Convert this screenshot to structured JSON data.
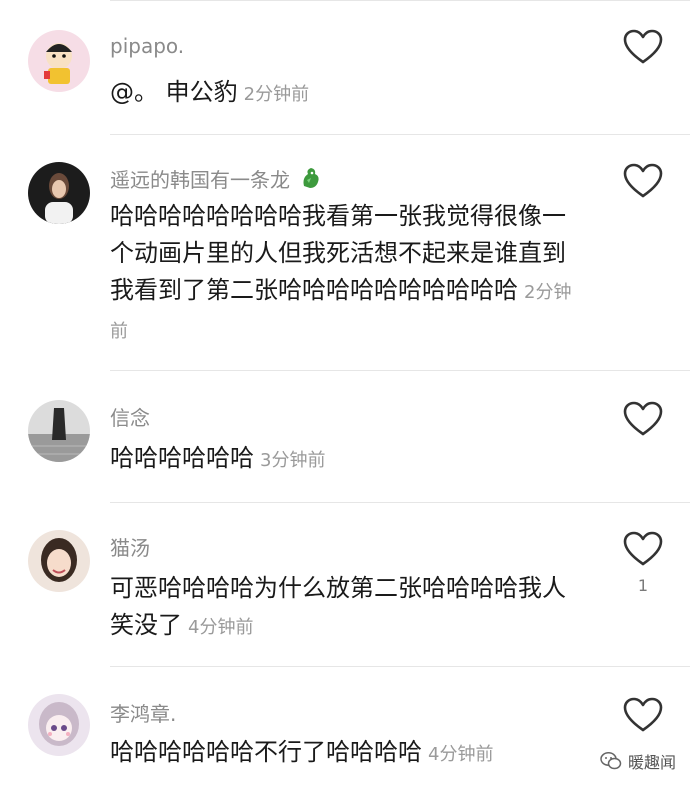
{
  "comments": [
    {
      "username": "pipapo.",
      "text": "@。 申公豹",
      "time": "2分钟前",
      "likes": ""
    },
    {
      "username": "遥远的韩国有一条龙",
      "text": "哈哈哈哈哈哈哈哈我看第一张我觉得很像一个动画片里的人但我死活想不起来是谁直到我看到了第二张哈哈哈哈哈哈哈哈哈哈",
      "time": "2分钟前",
      "likes": ""
    },
    {
      "username": "信念",
      "text": "哈哈哈哈哈哈",
      "time": "3分钟前",
      "likes": ""
    },
    {
      "username": "猫汤",
      "text": "可恶哈哈哈哈为什么放第二张哈哈哈哈我人笑没了",
      "time": "4分钟前",
      "likes": "1"
    },
    {
      "username": "李鸿章.",
      "text": "哈哈哈哈哈哈不行了哈哈哈哈",
      "time": "4分钟前",
      "likes": ""
    }
  ],
  "watermark": {
    "label": "暖趣闻"
  },
  "icons": {
    "like": "heart-outline-icon",
    "badge": "dragon-icon",
    "watermark": "wechat-icon"
  },
  "colors": {
    "username": "#8a8a8a",
    "time": "#9a9a9a",
    "divider": "#e6e6e6"
  }
}
